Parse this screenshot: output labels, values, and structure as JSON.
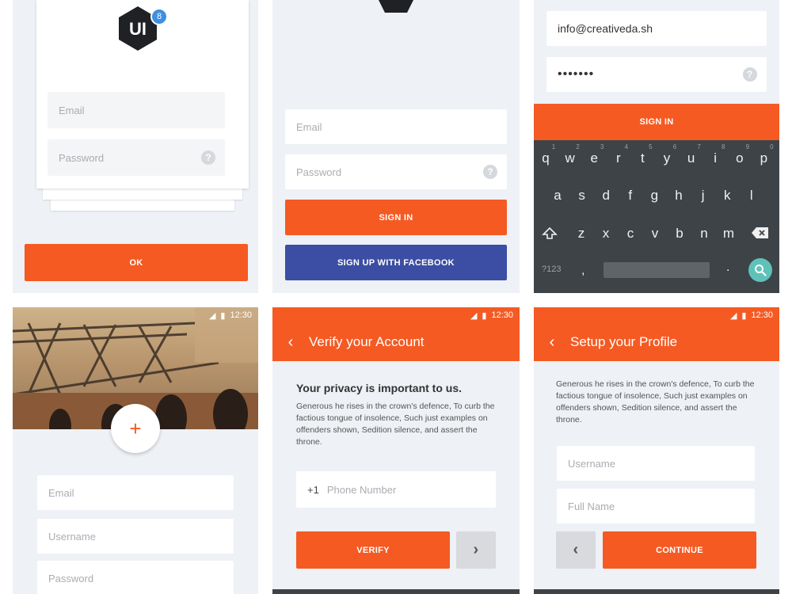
{
  "colors": {
    "accent": "#f55a23",
    "facebook": "#3b4ea3",
    "panel_bg": "#eef1f5",
    "keyboard": "#3e4347"
  },
  "icons": {
    "back": "chevron-left-icon",
    "next": "chevron-right-icon",
    "add": "plus-icon",
    "help": "question-icon",
    "search": "search-icon",
    "shift": "shift-icon",
    "backspace": "backspace-icon"
  },
  "status": {
    "time": "12:30"
  },
  "screen1": {
    "logo_text": "UI",
    "logo_badge": "8",
    "email_placeholder": "Email",
    "password_placeholder": "Password",
    "help_glyph": "?",
    "ok_label": "OK"
  },
  "screen2": {
    "email_placeholder": "Email",
    "password_placeholder": "Password",
    "help_glyph": "?",
    "signin_label": "SIGN IN",
    "facebook_label": "SIGN UP WITH FACEBOOK"
  },
  "screen3": {
    "email_value": "info@creativeda.sh",
    "password_value": "•••••••",
    "help_glyph": "?",
    "signin_label": "SIGN IN",
    "keyboard": {
      "row1": [
        "q",
        "w",
        "e",
        "r",
        "t",
        "y",
        "u",
        "i",
        "o",
        "p"
      ],
      "row1_numbers": [
        "1",
        "2",
        "3",
        "4",
        "5",
        "6",
        "7",
        "8",
        "9",
        "0"
      ],
      "row2": [
        "a",
        "s",
        "d",
        "f",
        "g",
        "h",
        "j",
        "k",
        "l"
      ],
      "row3": [
        "z",
        "x",
        "c",
        "v",
        "b",
        "n",
        "m"
      ],
      "symbols_key": "?123",
      "comma": ",",
      "period": "."
    }
  },
  "screen4": {
    "add_glyph": "+",
    "email_placeholder": "Email",
    "username_placeholder": "Username",
    "password_placeholder": "Password"
  },
  "screen5": {
    "back_glyph": "‹",
    "title": "Verify your Account",
    "heading": "Your privacy is important to us.",
    "body": "Generous he rises in the crown's defence, To curb the factious tongue of insolence, Such just examples on offenders shown, Sedition silence, and assert the throne.",
    "country_code": "+1",
    "phone_placeholder": "Phone Number",
    "verify_label": "VERIFY",
    "next_glyph": "›"
  },
  "screen6": {
    "back_glyph": "‹",
    "title": "Setup your Profile",
    "body": "Generous he rises in the crown's defence, To curb the factious tongue of insolence, Such just examples on offenders shown, Sedition silence, and assert the throne.",
    "username_placeholder": "Username",
    "fullname_placeholder": "Full Name",
    "prev_glyph": "‹",
    "continue_label": "CONTINUE"
  }
}
